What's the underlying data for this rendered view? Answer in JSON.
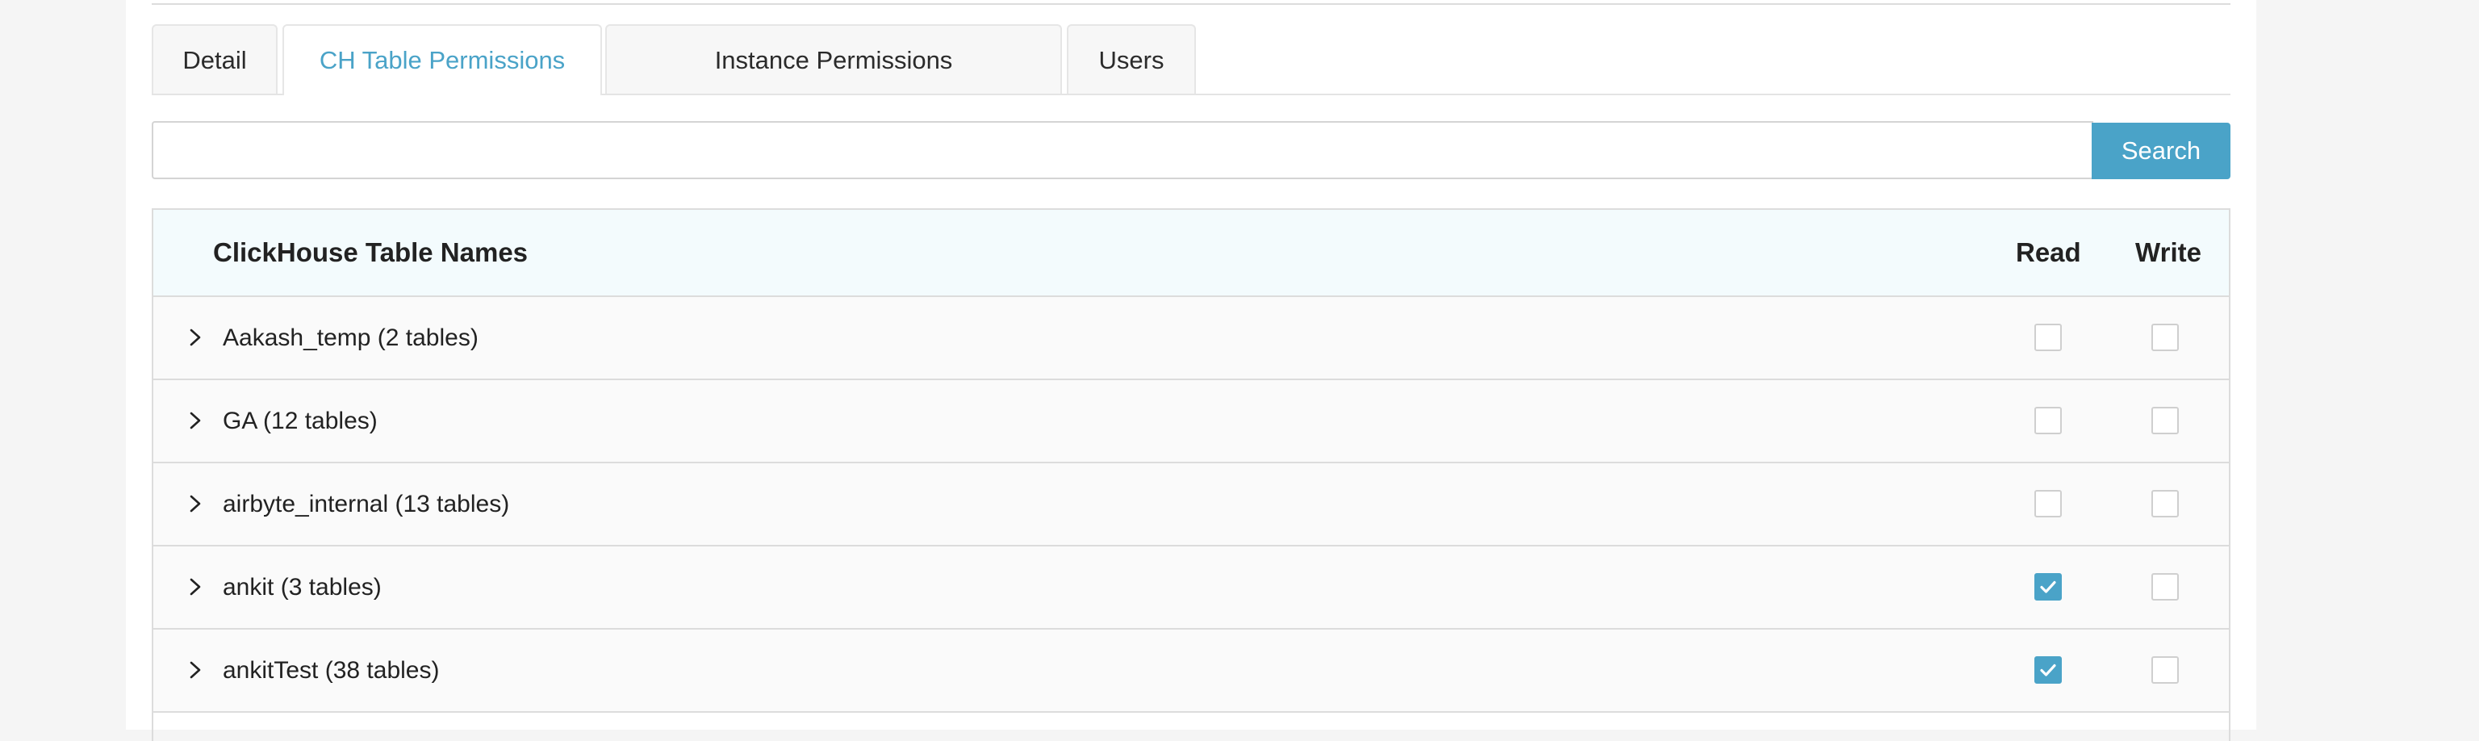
{
  "tabs": [
    {
      "label": "Detail",
      "active": false
    },
    {
      "label": "CH Table Permissions",
      "active": true
    },
    {
      "label": "Instance Permissions",
      "active": false
    },
    {
      "label": "Users",
      "active": false
    }
  ],
  "search": {
    "value": "",
    "placeholder": "",
    "button_label": "Search"
  },
  "table": {
    "headers": {
      "name": "ClickHouse Table Names",
      "read": "Read",
      "write": "Write"
    },
    "rows": [
      {
        "label": "Aakash_temp (2 tables)",
        "read": false,
        "write": false
      },
      {
        "label": "GA (12 tables)",
        "read": false,
        "write": false
      },
      {
        "label": "airbyte_internal (13 tables)",
        "read": false,
        "write": false
      },
      {
        "label": "ankit (3 tables)",
        "read": true,
        "write": false
      },
      {
        "label": "ankitTest (38 tables)",
        "read": true,
        "write": false
      }
    ]
  },
  "colors": {
    "accent": "#4aa3c8",
    "header_bg": "#f3fbfd",
    "row_bg": "#fafafa"
  },
  "icons": {
    "expand": "chevron-right-icon",
    "check": "checkmark-icon"
  }
}
